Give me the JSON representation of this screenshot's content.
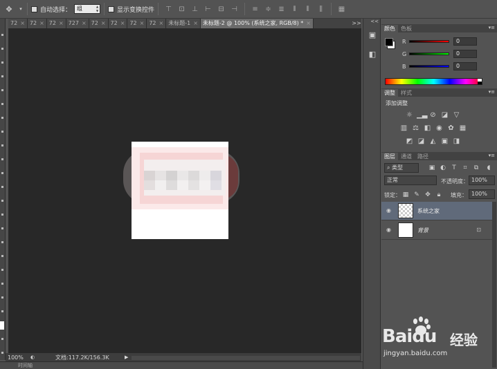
{
  "options_bar": {
    "auto_select_label": "自动选择：",
    "auto_select_value": "组",
    "show_transform_label": "显示变换控件"
  },
  "tabs": [
    {
      "label": "72",
      "close": "×"
    },
    {
      "label": "72",
      "close": "×"
    },
    {
      "label": "72",
      "close": "×"
    },
    {
      "label": "727",
      "close": "×"
    },
    {
      "label": "72",
      "close": "×"
    },
    {
      "label": "72",
      "close": "×"
    },
    {
      "label": "72",
      "close": "×"
    },
    {
      "label": "72",
      "close": "×"
    },
    {
      "label": "未标题-1",
      "close": "×"
    },
    {
      "label": "未标题-2 @ 100% (系统之家, RGB/8) *",
      "close": "×"
    }
  ],
  "tabs_more": ">>",
  "status": {
    "zoom": "100%",
    "doc_size": "文档:117.2K/156.3K"
  },
  "bottom_panel_label": "时间轴",
  "color_panel": {
    "tabs": [
      "颜色",
      "色板"
    ],
    "fg_color": "#000000",
    "bg_color": "#ffffff",
    "sliders": [
      {
        "letter": "R",
        "value": "0"
      },
      {
        "letter": "G",
        "value": "0"
      },
      {
        "letter": "B",
        "value": "0"
      }
    ]
  },
  "adjust_panel": {
    "tabs": [
      "调整",
      "样式"
    ],
    "title": "添加调整"
  },
  "layers_panel": {
    "tabs": [
      "图层",
      "通道",
      "路径"
    ],
    "filter_kind": "类型",
    "blend_mode": "正常",
    "opacity_label": "不透明度：",
    "opacity_value": "100%",
    "lock_label": "锁定：",
    "fill_label": "填充：",
    "fill_value": "100%",
    "layers": [
      {
        "name": "系统之家",
        "selected": true
      },
      {
        "name": "背景",
        "selected": false
      }
    ]
  },
  "watermark": {
    "brand": "Bai",
    "brand2": "du",
    "jingyan": "经验",
    "url": "jingyan.baidu.com"
  }
}
